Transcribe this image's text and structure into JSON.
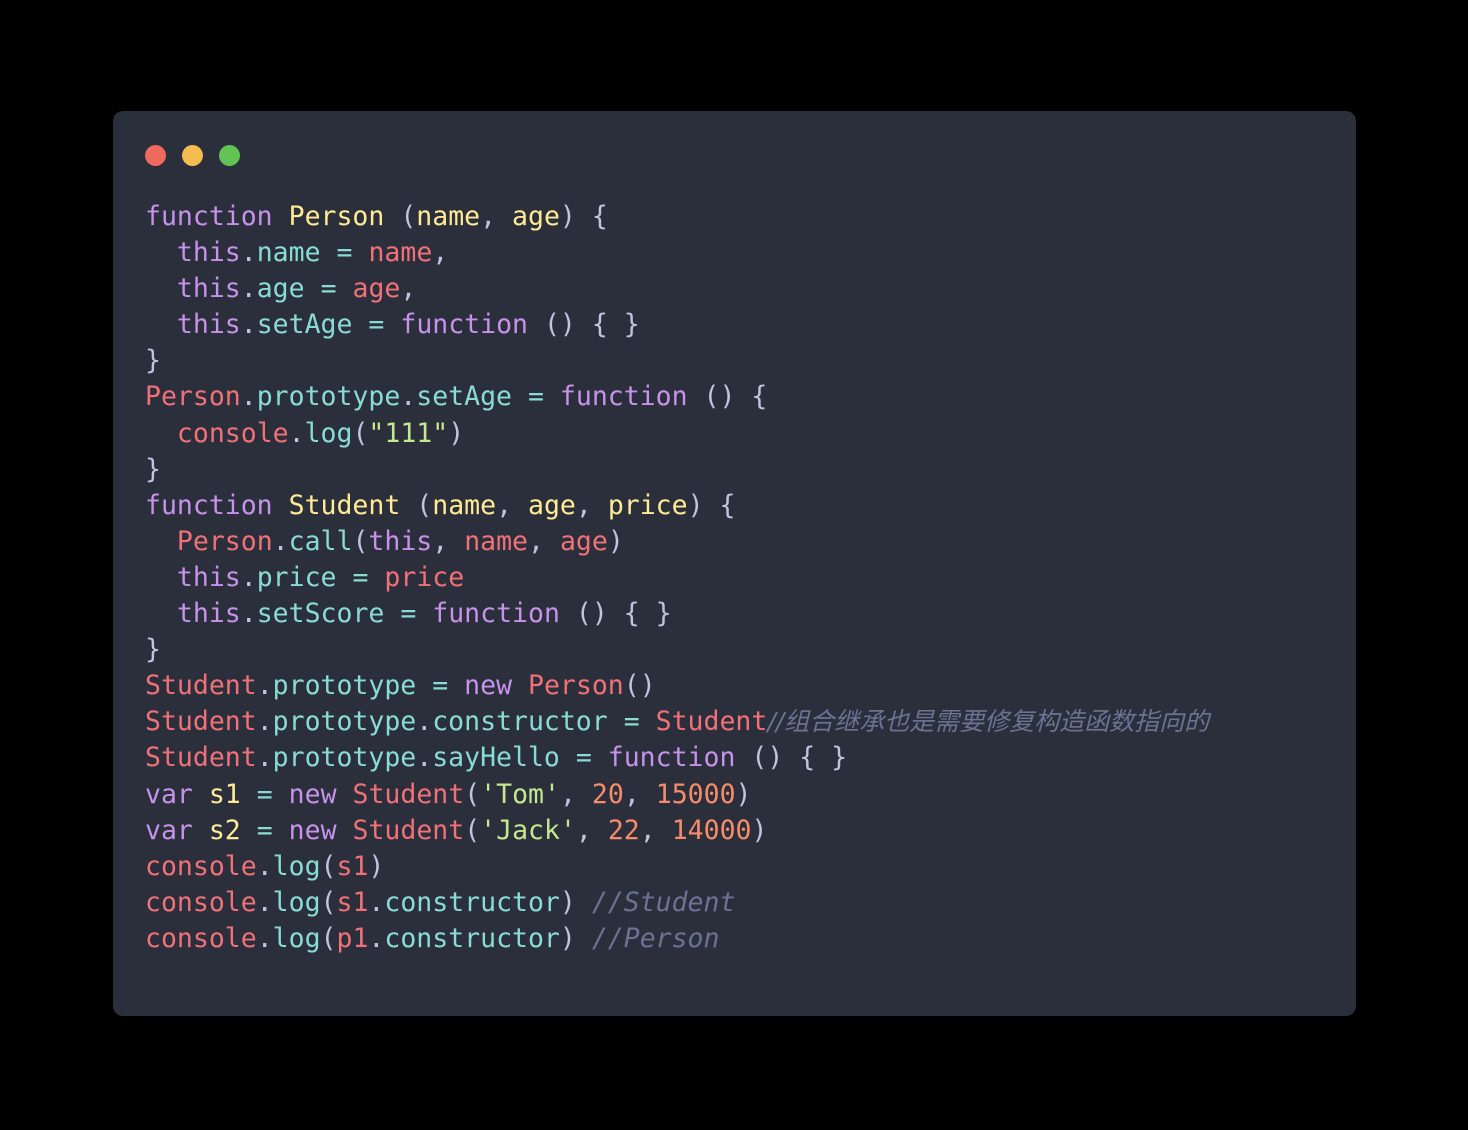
{
  "window": {
    "background_color": "#2B2E3B",
    "page_background_color": "#000000",
    "traffic_lights": [
      {
        "name": "close",
        "color": "#EE6A5F"
      },
      {
        "name": "minimize",
        "color": "#F5BD4F"
      },
      {
        "name": "maximize",
        "color": "#61C454"
      }
    ]
  },
  "theme": {
    "keyword": "#C792EA",
    "function_name": "#FFEB95",
    "parameter": "#FFEB95",
    "property": "#89DDD0",
    "variable": "#F07178",
    "object": "#F07178",
    "operator": "#89DDD0",
    "punctuation": "#BEC5DF",
    "string": "#C3E88D",
    "number": "#F78C6C",
    "comment": "#6B7394"
  },
  "code": {
    "language": "javascript",
    "full_text": "function Person (name, age) {\n  this.name = name,\n  this.age = age,\n  this.setAge = function () { }\n}\nPerson.prototype.setAge = function () {\n  console.log(\"111\")\n}\nfunction Student (name, age, price) {\n  Person.call(this, name, age)\n  this.price = price\n  this.setScore = function () { }\n}\nStudent.prototype = new Person()\nStudent.prototype.constructor = Student//组合继承也是需要修复构造函数指向的\nStudent.prototype.sayHello = function () { }\nvar s1 = new Student('Tom', 20, 15000)\nvar s2 = new Student('Jack', 22, 14000)\nconsole.log(s1)\nconsole.log(s1.constructor) //Student\nconsole.log(p1.constructor) //Person",
    "lines": [
      {
        "n": 1,
        "text": "function Person (name, age) {"
      },
      {
        "n": 2,
        "text": "  this.name = name,"
      },
      {
        "n": 3,
        "text": "  this.age = age,"
      },
      {
        "n": 4,
        "text": "  this.setAge = function () { }"
      },
      {
        "n": 5,
        "text": "}"
      },
      {
        "n": 6,
        "text": "Person.prototype.setAge = function () {"
      },
      {
        "n": 7,
        "text": "  console.log(\"111\")"
      },
      {
        "n": 8,
        "text": "}"
      },
      {
        "n": 9,
        "text": "function Student (name, age, price) {"
      },
      {
        "n": 10,
        "text": "  Person.call(this, name, age)"
      },
      {
        "n": 11,
        "text": "  this.price = price"
      },
      {
        "n": 12,
        "text": "  this.setScore = function () { }"
      },
      {
        "n": 13,
        "text": "}"
      },
      {
        "n": 14,
        "text": "Student.prototype = new Person()"
      },
      {
        "n": 15,
        "text": "Student.prototype.constructor = Student//组合继承也是需要修复构造函数指向的"
      },
      {
        "n": 16,
        "text": "Student.prototype.sayHello = function () { }"
      },
      {
        "n": 17,
        "text": "var s1 = new Student('Tom', 20, 15000)"
      },
      {
        "n": 18,
        "text": "var s2 = new Student('Jack', 22, 14000)"
      },
      {
        "n": 19,
        "text": "console.log(s1)"
      },
      {
        "n": 20,
        "text": "console.log(s1.constructor) //Student"
      },
      {
        "n": 21,
        "text": "console.log(p1.constructor) //Person"
      }
    ],
    "tokens": {
      "keywords": [
        "function",
        "var",
        "new",
        "this"
      ],
      "identifiers": [
        "Person",
        "Student",
        "console",
        "s1",
        "s2",
        "p1"
      ],
      "properties": [
        "name",
        "age",
        "setAge",
        "price",
        "setScore",
        "prototype",
        "constructor",
        "sayHello",
        "log",
        "call"
      ],
      "strings": [
        "\"111\"",
        "'Tom'",
        "'Jack'"
      ],
      "numbers": [
        "20",
        "15000",
        "22",
        "14000"
      ],
      "comments": [
        "//组合继承也是需要修复构造函数指向的",
        "//Student",
        "//Person"
      ]
    }
  }
}
